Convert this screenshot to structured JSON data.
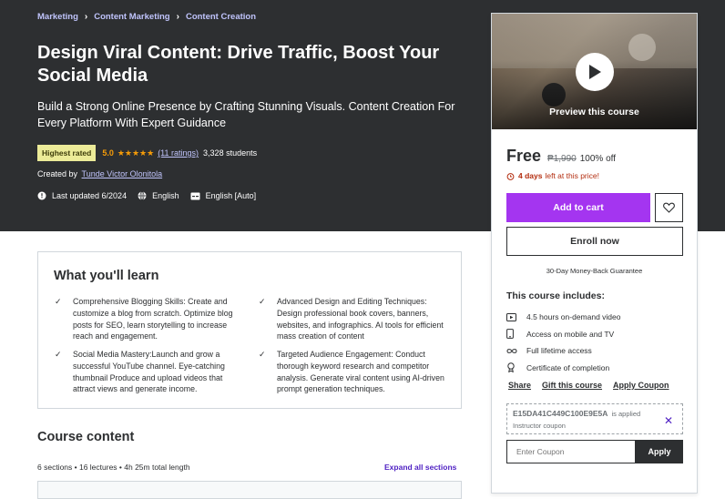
{
  "breadcrumb": [
    "Marketing",
    "Content Marketing",
    "Content Creation"
  ],
  "course": {
    "title": "Design Viral Content: Drive Traffic, Boost Your Social Media",
    "subtitle": "Build a Strong Online Presence by Crafting Stunning Visuals. Content Creation For Every Platform With Expert Guidance",
    "badge": "Highest rated",
    "rating": "5.0",
    "stars": "★★★★★",
    "ratings_count": "(11 ratings)",
    "students": "3,328 students",
    "created_by_label": "Created by",
    "author": "Tunde Victor Olonitola",
    "last_updated": "Last updated 6/2024",
    "language": "English",
    "captions": "English [Auto]"
  },
  "sidebar": {
    "preview_label": "Preview this course",
    "price": "Free",
    "original_price": "₱1,990",
    "discount": "100% off",
    "timer_bold": "4 days",
    "timer_text": "left at this price!",
    "add_to_cart": "Add to cart",
    "enroll": "Enroll now",
    "guarantee": "30-Day Money-Back Guarantee",
    "includes_title": "This course includes:",
    "includes": [
      {
        "icon": "video-icon",
        "label": "4.5 hours on-demand video"
      },
      {
        "icon": "mobile-icon",
        "label": "Access on mobile and TV"
      },
      {
        "icon": "infinity-icon",
        "label": "Full lifetime access"
      },
      {
        "icon": "certificate-icon",
        "label": "Certificate of completion"
      }
    ],
    "links": [
      "Share",
      "Gift this course",
      "Apply Coupon"
    ],
    "coupon_code": "E15DA41C449C100E9E5A",
    "coupon_applied": "is applied",
    "coupon_sub": "Instructor coupon",
    "coupon_placeholder": "Enter Coupon",
    "coupon_apply": "Apply"
  },
  "learn": {
    "title": "What you'll learn",
    "items": [
      "Comprehensive Blogging Skills: Create and customize a blog from scratch. Optimize blog posts for SEO, learn storytelling to increase reach and engagement.",
      "Advanced Design and Editing Techniques: Design professional book covers, banners, websites, and infographics. AI tools for efficient mass creation of content",
      "Social Media Mastery:Launch and grow a successful YouTube channel. Eye-catching thumbnail Produce and upload videos that attract views and generate income.",
      "Targeted Audience Engagement: Conduct thorough keyword research and competitor analysis. Generate viral content using AI-driven prompt generation techniques."
    ]
  },
  "content": {
    "title": "Course content",
    "meta": "6 sections • 16 lectures • 4h 25m total length",
    "expand": "Expand all sections"
  },
  "colors": {
    "hero_bg": "#2d2f31",
    "accent": "#a435f0",
    "link": "#c0c4fc",
    "star": "#f69c08",
    "badge": "#eceb98"
  }
}
